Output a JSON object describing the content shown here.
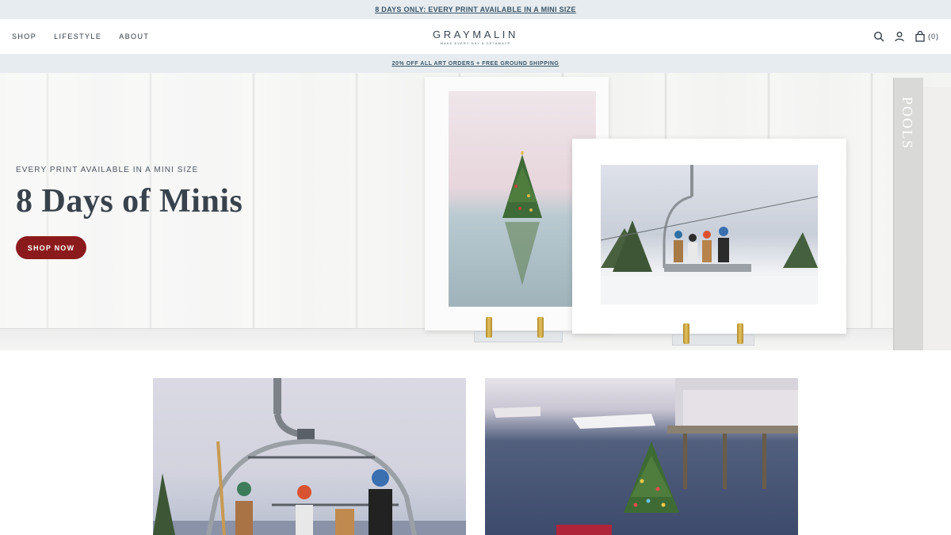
{
  "announcement": {
    "text": "8 DAYS ONLY: EVERY PRINT AVAILABLE IN A MINI SIZE"
  },
  "header": {
    "nav": [
      "SHOP",
      "LIFESTYLE",
      "ABOUT"
    ],
    "logo": {
      "name": "GRAYMALIN",
      "tagline": "MAKE EVERY DAY A GETAWAY®"
    },
    "icons": [
      "search-icon",
      "account-icon",
      "bag-icon"
    ],
    "cart_count": "(0)"
  },
  "promo": {
    "text": "20% OFF ALL ART ORDERS + FREE GROUND SHIPPING"
  },
  "hero": {
    "eyebrow": "EVERY PRINT AVAILABLE IN A MINI SIZE",
    "title": "8 Days of Minis",
    "cta": "SHOP NOW",
    "book_spine": "POOLS"
  },
  "colors": {
    "accent": "#8b1a1c",
    "bar_bg": "#e6ecef",
    "link": "#3a5569",
    "text": "#2f3a44"
  }
}
